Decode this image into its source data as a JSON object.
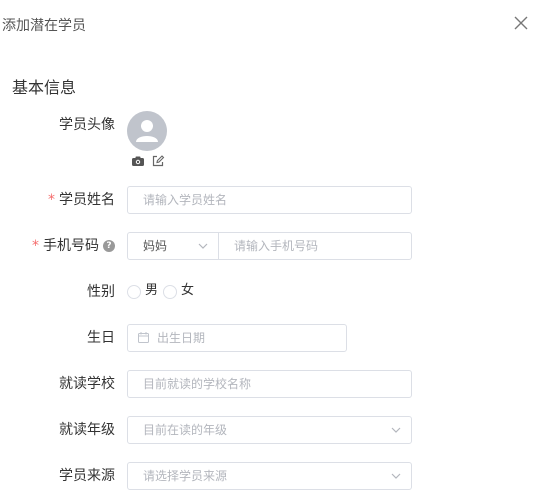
{
  "dialog": {
    "title": "添加潜在学员",
    "close_icon": "close-icon"
  },
  "section": {
    "title": "基本信息"
  },
  "avatar": {
    "label": "学员头像",
    "icon": "user-avatar-icon",
    "tools": [
      "camera-icon",
      "edit-icon"
    ]
  },
  "name": {
    "label": "学员姓名",
    "required": "*",
    "placeholder": "请输入学员姓名"
  },
  "phone": {
    "label": "手机号码",
    "required": "*",
    "help": "?",
    "relation_value": "妈妈",
    "placeholder": "请输入手机号码"
  },
  "gender": {
    "label": "性别",
    "options": [
      "男",
      "女"
    ]
  },
  "birthday": {
    "label": "生日",
    "placeholder": "出生日期",
    "icon": "calendar-icon"
  },
  "school": {
    "label": "就读学校",
    "placeholder": "目前就读的学校名称"
  },
  "grade": {
    "label": "就读年级",
    "placeholder": "目前在读的年级"
  },
  "source": {
    "label": "学员来源",
    "placeholder": "请选择学员来源"
  }
}
